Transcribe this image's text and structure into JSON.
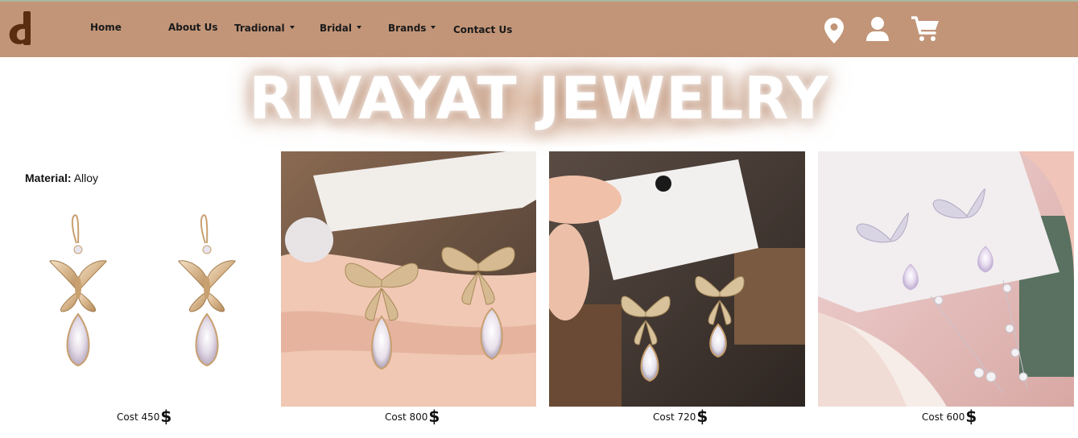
{
  "nav": {
    "items": [
      {
        "label": "Home"
      },
      {
        "label": "About Us"
      },
      {
        "label": "Tradional"
      },
      {
        "label": "Bridal"
      },
      {
        "label": "Brands"
      },
      {
        "label": "Contact Us"
      }
    ],
    "icons": [
      "map-pin-icon",
      "user-icon",
      "cart-icon"
    ]
  },
  "hero": {
    "title": "RIVAYAT JEWELRY"
  },
  "product_detail": {
    "material_label": "Material:",
    "material_value": "Alloy"
  },
  "products": [
    {
      "cost_label": "Cost",
      "price": "450",
      "currency": "$"
    },
    {
      "cost_label": "Cost",
      "price": "800",
      "currency": "$"
    },
    {
      "cost_label": "Cost",
      "price": "720",
      "currency": "$"
    },
    {
      "cost_label": "Cost",
      "price": "600",
      "currency": "$"
    }
  ],
  "colors": {
    "navbar": "#c29578",
    "logo": "#5a2d10"
  }
}
